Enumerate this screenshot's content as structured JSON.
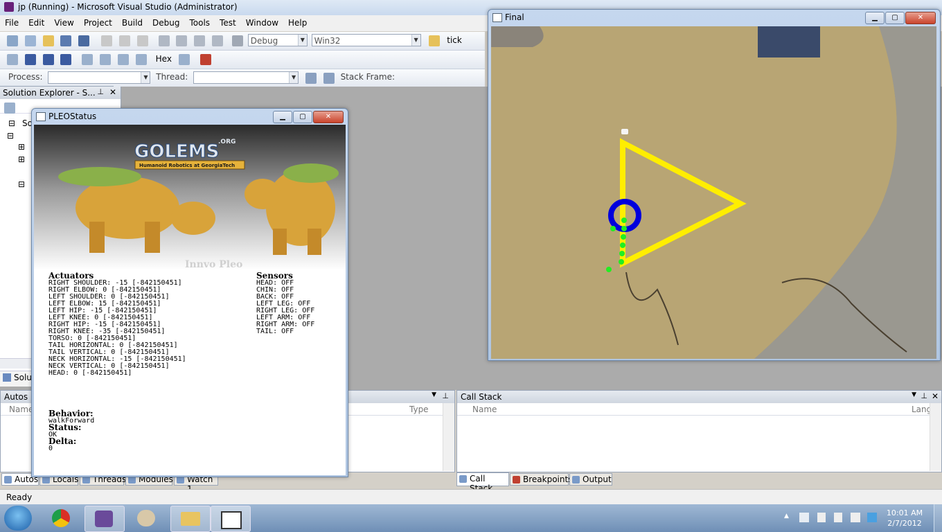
{
  "vs": {
    "title": "jp (Running) - Microsoft Visual Studio (Administrator)",
    "menu": [
      "File",
      "Edit",
      "View",
      "Project",
      "Build",
      "Debug",
      "Tools",
      "Test",
      "Window",
      "Help"
    ],
    "config": "Debug",
    "platform": "Win32",
    "find_text": "tick",
    "hex_label": "Hex",
    "process_label": "Process:",
    "thread_label": "Thread:",
    "stackframe_label": "Stack Frame:",
    "solution_explorer_title": "Solution Explorer - S...",
    "solution_explorer_tab": "Solu",
    "solution_root": "So",
    "autos": {
      "title": "Autos",
      "col_name": "Name",
      "col_type": "Type"
    },
    "callstack": {
      "title": "Call Stack",
      "col_name": "Name",
      "col_lang": "Lang"
    },
    "bottom_tabs_left": [
      "Autos",
      "Locals",
      "Threads",
      "Modules",
      "Watch 1"
    ],
    "bottom_tabs_right": [
      "Call Stack",
      "Breakpoints",
      "Output"
    ],
    "status": "Ready"
  },
  "pleo": {
    "title": "PLEOStatus",
    "logo_main": "GOLEMS",
    "logo_org": ".ORG",
    "logo_sub": "Humanoid Robotics at GeorgiaTech",
    "watermark": "Innvo Pleo",
    "actuators_title": "Actuators",
    "actuators": [
      "RIGHT SHOULDER: -15 [-842150451]",
      "RIGHT ELBOW: 0 [-842150451]",
      "LEFT SHOULDER: 0 [-842150451]",
      "LEFT ELBOW: 15 [-842150451]",
      "LEFT HIP: -15 [-842150451]",
      "LEFT KNEE: 0 [-842150451]",
      "RIGHT HIP: -15 [-842150451]",
      "RIGHT KNEE: -35 [-842150451]",
      "TORSO: 0 [-842150451]",
      "TAIL HORIZONTAL: 0 [-842150451]",
      "TAIL VERTICAL: 0 [-842150451]",
      "NECK HORIZONTAL: -15 [-842150451]",
      "NECK VERTICAL: 0 [-842150451]",
      "HEAD: 0 [-842150451]"
    ],
    "sensors_title": "Sensors",
    "sensors": [
      "HEAD: OFF",
      "CHIN: OFF",
      "BACK: OFF",
      "LEFT LEG: OFF",
      "RIGHT LEG: OFF",
      "LEFT ARM: OFF",
      "RIGHT ARM: OFF",
      "TAIL: OFF"
    ],
    "behavior_label": "Behavior:",
    "behavior_value": "walkForward",
    "status_label": "Status:",
    "status_value": "OK",
    "delta_label": "Delta:",
    "delta_value": "0"
  },
  "final": {
    "title": "Final"
  },
  "tray": {
    "time": "10:01 AM",
    "date": "2/7/2012"
  },
  "colors": {
    "triangle": "#ffee00",
    "ring": "#0000dd",
    "dots": "#22ee22"
  }
}
